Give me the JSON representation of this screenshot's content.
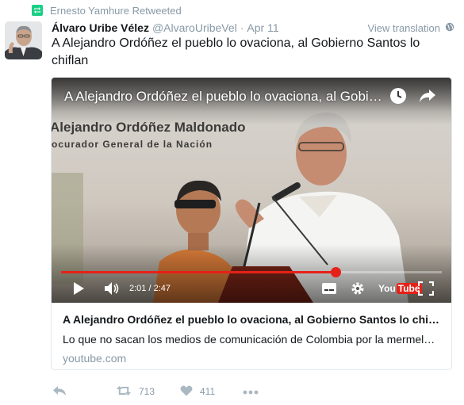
{
  "retweet_context": {
    "text": "Ernesto Yamhure Retweeted",
    "icon": "retweet-icon",
    "color": "#19cf86"
  },
  "tweet": {
    "fullname": "Álvaro Uribe Vélez",
    "username": "@AlvaroUribeVel",
    "separator": "·",
    "timestamp": "Apr 11",
    "translate_label": "View translation",
    "translate_icon": "globe-icon",
    "text": "A Alejandro Ordóñez el pueblo lo ovaciona, al Gobierno Santos lo chiflan"
  },
  "card": {
    "video": {
      "overlay_title": "A Alejandro Ordóñez el pueblo lo ovaciona, al Gobierno Santos lo chiflan",
      "caption_line1": "Alejandro Ordóñez Maldonado",
      "caption_line2": "ocurador General de la Nación",
      "current_time": "2:01",
      "duration": "2:47",
      "progress": 0.72,
      "time_display": "2:01 / 2:47",
      "logo_you": "You",
      "logo_tube": "Tube",
      "progress_color": "#e62117"
    },
    "title": "A Alejandro Ordóñez el pueblo lo ovaciona, al Gobierno Santos lo chiflan",
    "description": "Lo que no sacan los medios de comunicación de Colombia por la mermelada",
    "domain": "youtube.com"
  },
  "actions": {
    "reply_icon": "reply-icon",
    "retweet_count": "713",
    "like_count": "411",
    "more_icon": "more-icon"
  },
  "colors": {
    "muted": "#8899a6",
    "text": "#14171a",
    "border": "#e1e8ed"
  }
}
